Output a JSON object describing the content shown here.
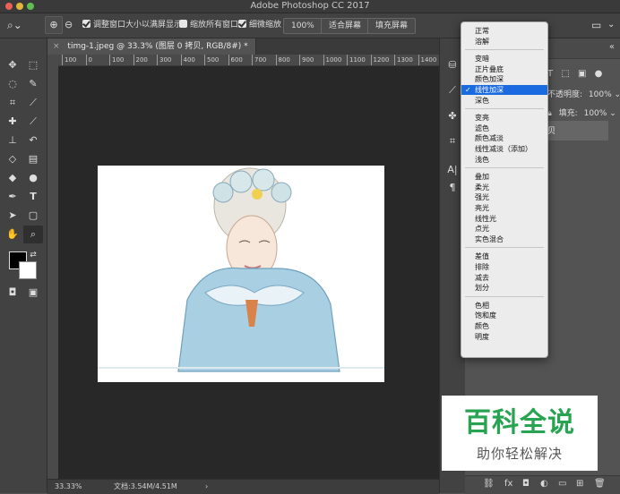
{
  "window": {
    "title": "Adobe Photoshop CC 2017"
  },
  "options_bar": {
    "resize_windows_label": "调整窗口大小以满屏显示",
    "zoom_all_label": "缩放所有窗口",
    "scrubby_zoom_label": "细微缩放",
    "zoom_value": "100%",
    "fit_screen_label": "适合屏幕",
    "fill_screen_label": "填充屏幕",
    "resize_windows_checked": true,
    "zoom_all_checked": false,
    "scrubby_zoom_checked": true
  },
  "document": {
    "tab_title": "timg-1.jpeg @ 33.3% (图层 0 拷贝, RGB/8#) *",
    "ruler_ticks": [
      "100",
      "0",
      "100",
      "200",
      "300",
      "400",
      "500",
      "600",
      "700",
      "800",
      "900",
      "1000",
      "1100",
      "1200",
      "1300",
      "1400"
    ],
    "zoom": "33.33%",
    "doc_info": "文档:3.54M/4.51M"
  },
  "layers_panel": {
    "opacity_label": "不透明度:",
    "opacity_value": "100%",
    "fill_label": "填充:",
    "fill_value": "100%",
    "layer_partial_name": "贝"
  },
  "blend_menu": {
    "groups": [
      [
        "正常",
        "溶解"
      ],
      [
        "变暗",
        "正片叠底",
        "颜色加深",
        "线性加深",
        "深色"
      ],
      [
        "变亮",
        "滤色",
        "颜色减淡",
        "线性减淡（添加）",
        "浅色"
      ],
      [
        "叠加",
        "柔光",
        "强光",
        "亮光",
        "线性光",
        "点光",
        "实色混合"
      ],
      [
        "差值",
        "排除",
        "减去",
        "划分"
      ],
      [
        "色相",
        "饱和度",
        "颜色",
        "明度"
      ]
    ],
    "selected": "线性加深"
  },
  "watermark": {
    "title": "百科全说",
    "subtitle": "助你轻松解决"
  },
  "colors": {
    "accent": "#1a6ae0",
    "watermark_green": "#27a352"
  }
}
